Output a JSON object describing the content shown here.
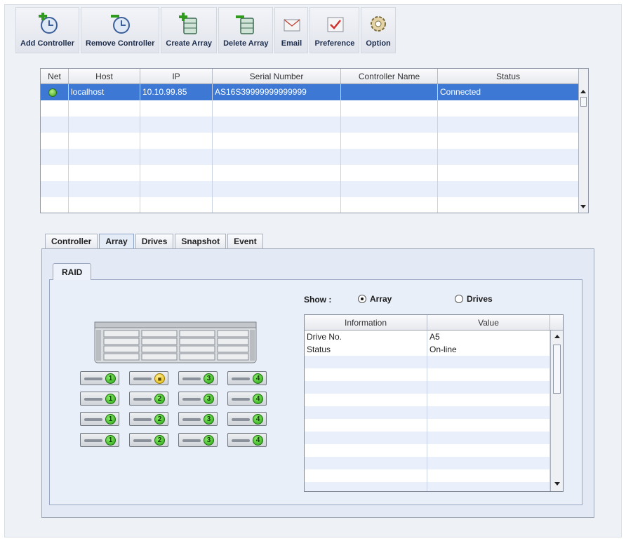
{
  "toolbar": [
    {
      "label": "Add Controller",
      "icon": "add-controller-icon"
    },
    {
      "label": "Remove Controller",
      "icon": "remove-controller-icon"
    },
    {
      "label": "Create Array",
      "icon": "create-array-icon"
    },
    {
      "label": "Delete Array",
      "icon": "delete-array-icon"
    },
    {
      "label": "Email",
      "icon": "email-icon"
    },
    {
      "label": "Preference",
      "icon": "preference-icon"
    },
    {
      "label": "Option",
      "icon": "option-gear-icon"
    }
  ],
  "controllers": {
    "columns": [
      "Net",
      "Host",
      "IP",
      "Serial Number",
      "Controller Name",
      "Status"
    ],
    "rows": [
      {
        "net": "connected-indicator",
        "host": "localhost",
        "ip": "10.10.99.85",
        "serial": "AS16S39999999999999",
        "name": "",
        "status": "Connected",
        "selected": true
      }
    ]
  },
  "tabs": [
    {
      "label": "Controller",
      "active": false
    },
    {
      "label": "Array",
      "active": true
    },
    {
      "label": "Drives",
      "active": false
    },
    {
      "label": "Snapshot",
      "active": false
    },
    {
      "label": "Event",
      "active": false
    }
  ],
  "subtab": "RAID",
  "show": {
    "label": "Show :",
    "options": [
      {
        "label": "Array",
        "selected": true
      },
      {
        "label": "Drives",
        "selected": false
      }
    ]
  },
  "info_table": {
    "columns": [
      "Information",
      "Value"
    ],
    "rows": [
      {
        "info": "Drive No.",
        "value": "A5"
      },
      {
        "info": "Status",
        "value": "On-line"
      }
    ]
  },
  "drive_bays": [
    [
      "1",
      "lock",
      "3",
      "4"
    ],
    [
      "1",
      "2",
      "3",
      "4"
    ],
    [
      "1",
      "2",
      "3",
      "4"
    ],
    [
      "1",
      "2",
      "3",
      "4"
    ]
  ],
  "colors": {
    "selection": "#3d78d5",
    "alt_row": "#e9f0fb",
    "online_green": "#25a114",
    "locked_yellow": "#e0b400"
  }
}
